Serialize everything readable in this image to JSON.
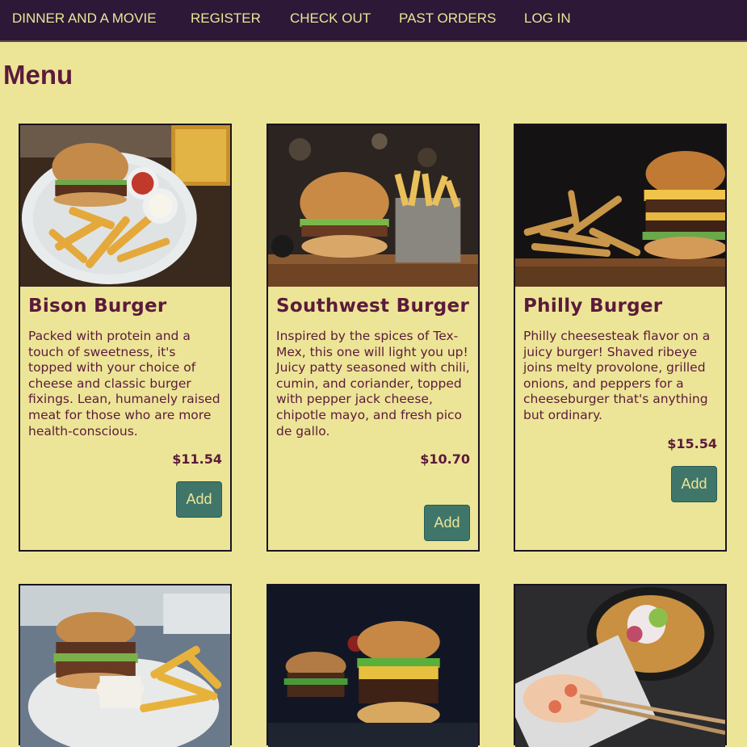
{
  "nav": {
    "brand": "DINNER AND A MOVIE",
    "register": "REGISTER",
    "checkout": "CHECK OUT",
    "past_orders": "PAST ORDERS",
    "login": "LOG IN"
  },
  "page": {
    "title": "Menu"
  },
  "menu": [
    {
      "name": "Bison Burger",
      "description": "Packed with protein and a touch of sweetness, it's topped with your choice of cheese and classic burger fixings. Lean, humanely raised meat for those who are more health-conscious.",
      "price": "$11.54",
      "add_label": "Add"
    },
    {
      "name": "Southwest Burger",
      "description": "Inspired by the spices of Tex-Mex, this one will light you up! Juicy patty seasoned with chili, cumin, and coriander, topped with pepper jack cheese, chipotle mayo, and fresh pico de gallo.",
      "price": "$10.70",
      "add_label": "Add"
    },
    {
      "name": "Philly Burger",
      "description": "Philly cheesesteak flavor on a juicy burger! Shaved ribeye joins melty provolone, grilled onions, and peppers for a cheeseburger that's anything but ordinary.",
      "price": "$15.54",
      "add_label": "Add"
    }
  ]
}
